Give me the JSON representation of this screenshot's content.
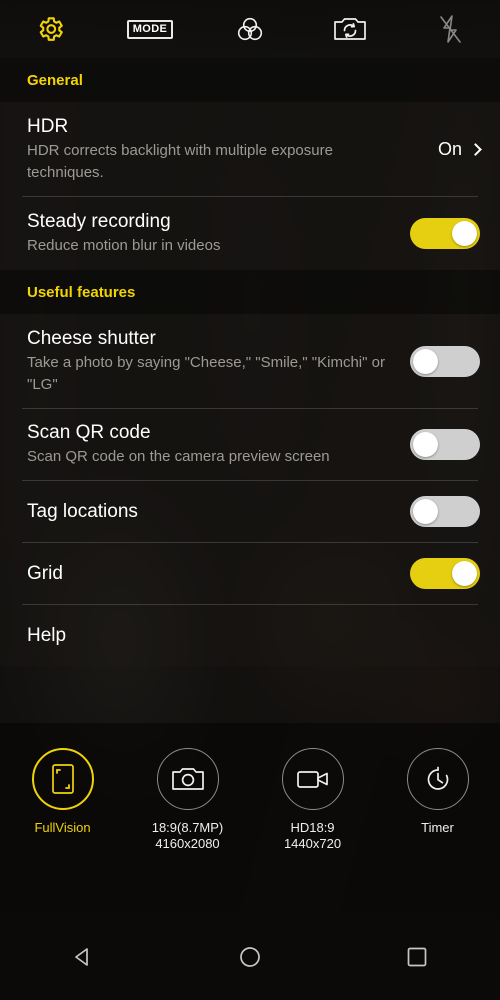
{
  "topbar": {
    "items": [
      {
        "name": "settings-icon",
        "label": "Settings",
        "active": true
      },
      {
        "name": "mode-icon",
        "label": "MODE",
        "active": false
      },
      {
        "name": "color-filter-icon",
        "label": "Color filter",
        "active": false
      },
      {
        "name": "camera-switch-icon",
        "label": "Switch camera",
        "active": false
      },
      {
        "name": "flash-off-icon",
        "label": "Flash off",
        "active": false
      }
    ]
  },
  "settings": {
    "sections": [
      {
        "header": "General",
        "rows": [
          {
            "title": "HDR",
            "desc": "HDR corrects backlight with multiple exposure techniques.",
            "control": "value",
            "value": "On"
          },
          {
            "title": "Steady recording",
            "desc": "Reduce motion blur in videos",
            "control": "toggle",
            "value": "on"
          }
        ]
      },
      {
        "header": "Useful features",
        "rows": [
          {
            "title": "Cheese shutter",
            "desc": "Take a photo by saying \"Cheese,\" \"Smile,\" \"Kimchi\" or \"LG\"",
            "control": "toggle",
            "value": "off"
          },
          {
            "title": "Scan QR code",
            "desc": "Scan QR code on the camera preview screen",
            "control": "toggle",
            "value": "off"
          },
          {
            "title": "Tag locations",
            "desc": "",
            "control": "toggle",
            "value": "off"
          },
          {
            "title": "Grid",
            "desc": "",
            "control": "toggle",
            "value": "on"
          },
          {
            "title": "Help",
            "desc": "",
            "control": "none",
            "value": ""
          }
        ]
      }
    ]
  },
  "modes": [
    {
      "icon": "fullvision-icon",
      "label": "FullVision",
      "sublabel": "",
      "active": true
    },
    {
      "icon": "photo-camera-icon",
      "label": "18:9(8.7MP)",
      "sublabel": "4160x2080",
      "active": false
    },
    {
      "icon": "video-camera-icon",
      "label": "HD18:9",
      "sublabel": "1440x720",
      "active": false
    },
    {
      "icon": "timer-icon",
      "label": "Timer",
      "sublabel": "",
      "active": false
    }
  ],
  "navbar": [
    {
      "name": "back-button",
      "label": "Back"
    },
    {
      "name": "home-button",
      "label": "Home"
    },
    {
      "name": "recents-button",
      "label": "Recents"
    }
  ],
  "colors": {
    "accent": "#f0d20a",
    "toggle_on": "#e5cf10",
    "toggle_off": "#cfcfcf",
    "title_text": "#ffffff",
    "desc_text": "#9d9a95"
  }
}
